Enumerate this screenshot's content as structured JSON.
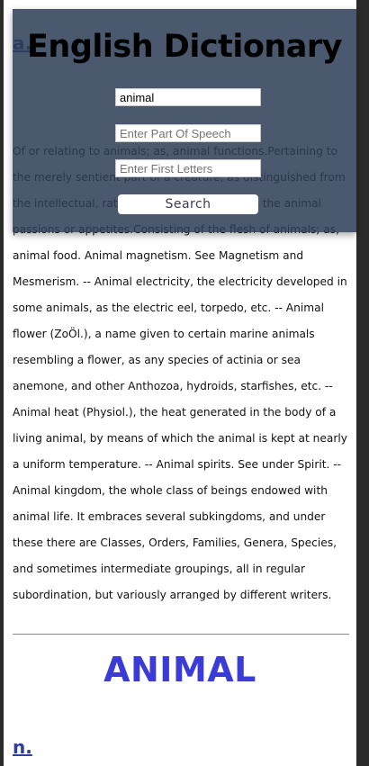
{
  "app": {
    "title": "English Dictionary"
  },
  "search": {
    "word_value": "animal",
    "pos_placeholder": "Enter Part Of Speech",
    "letters_placeholder": "Enter First Letters",
    "button_label": "Search"
  },
  "entry_top": {
    "pos": "a.",
    "definition": "Of or relating to animals; as, animal functions.Pertaining to the merely sentient part of a creature, as distinguished from the intellectual, rational, or spiritual part; as, the animal passions or appetites.Consisting of the flesh of animals; as, animal food. Animal magnetism. See Magnetism and Mesmerism. -- Animal electricity, the electricity developed in some animals, as the electric eel, torpedo, etc. -- Animal flower (ZoÖl.), a name given to certain marine animals resembling a flower, as any species of actinia or sea anemone, and other Anthozoa, hydroids, starfishes, etc. -- Animal heat (Physiol.), the heat generated in the body of a living animal, by means of which the animal is kept at nearly a uniform temperature. -- Animal spirits. See under Spirit. -- Animal kingdom, the whole class of beings endowed with animal life. It embraces several subkingdoms, and under these there are Classes, Orders, Families, Genera, Species, and sometimes intermediate groupings, all in regular subordination, but variously arranged by different writers."
  },
  "entry_bottom": {
    "word": "ANIMAL",
    "pos": "n."
  },
  "colors": {
    "overlay": "#2c3e56",
    "pos_link": "#2c3e9e",
    "word_heading": "#3b3bd8"
  }
}
